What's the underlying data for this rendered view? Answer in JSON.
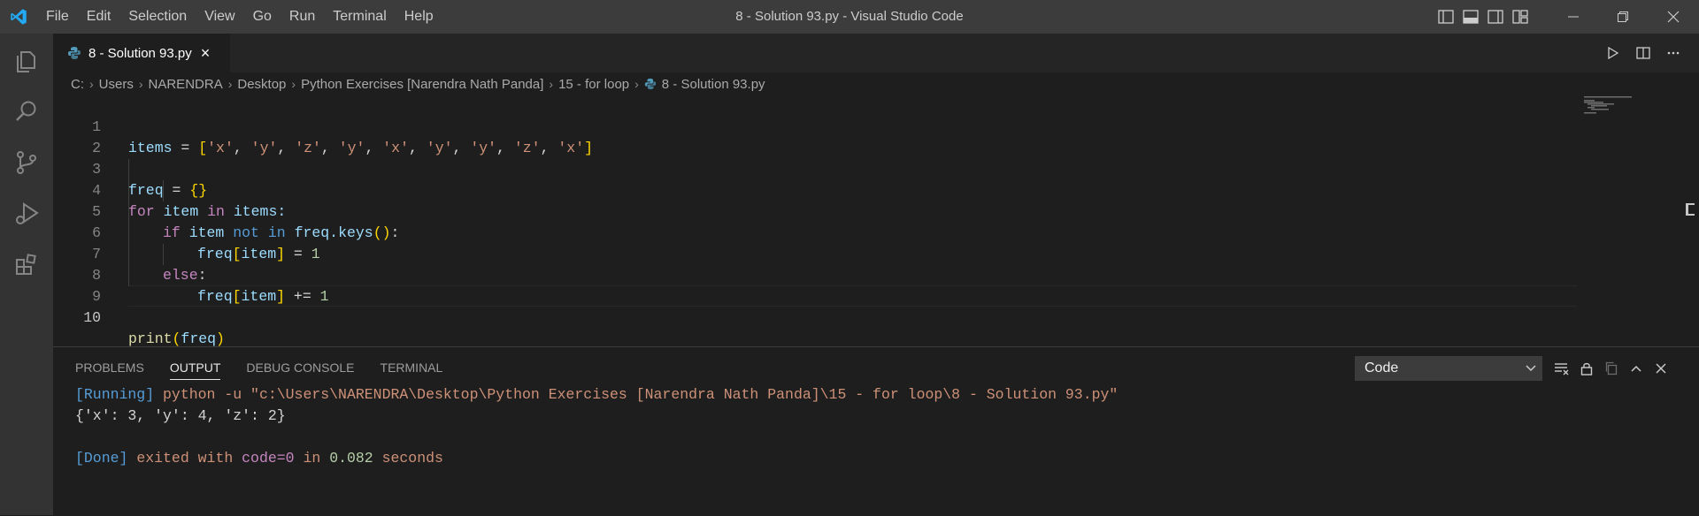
{
  "window": {
    "title": "8 - Solution 93.py - Visual Studio Code",
    "menu": [
      "File",
      "Edit",
      "Selection",
      "View",
      "Go",
      "Run",
      "Terminal",
      "Help"
    ]
  },
  "tab": {
    "label": "8 - Solution 93.py"
  },
  "breadcrumb": [
    "C:",
    "Users",
    "NARENDRA",
    "Desktop",
    "Python Exercises [Narendra Nath Panda]",
    "15 - for loop",
    "8 - Solution 93.py"
  ],
  "editor": {
    "line_numbers": [
      "1",
      "2",
      "3",
      "4",
      "5",
      "6",
      "7",
      "8",
      "9",
      "10"
    ],
    "active_line": "10",
    "code": {
      "l1_items": "items",
      "l1_eq": " = ",
      "l1_lb": "[",
      "l1_values": [
        "'x'",
        "'y'",
        "'z'",
        "'y'",
        "'x'",
        "'y'",
        "'y'",
        "'z'",
        "'x'"
      ],
      "l1_sep": ", ",
      "l1_rb": "]",
      "l3_freq": "freq",
      "l3_eq": " = ",
      "l3_braces": "{}",
      "l4_for": "for",
      "l4_item": " item ",
      "l4_in": "in",
      "l4_items": " items:",
      "l5_if": "if",
      "l5_item": " item ",
      "l5_not": "not",
      "l5_in": "in",
      "l5_freq": " freq.keys",
      "l5_parens": "()",
      "l5_colon": ":",
      "l6_freq": "freq",
      "l6_lb": "[",
      "l6_item": "item",
      "l6_rb": "]",
      "l6_op": " = ",
      "l6_num": "1",
      "l7_else": "else",
      "l7_colon": ":",
      "l8_freq": "freq",
      "l8_lb": "[",
      "l8_item": "item",
      "l8_rb": "]",
      "l8_op": " += ",
      "l8_num": "1",
      "l10_print": "print",
      "l10_lp": "(",
      "l10_freq": "freq",
      "l10_rp": ")"
    }
  },
  "panel": {
    "tabs": [
      "PROBLEMS",
      "OUTPUT",
      "DEBUG CONSOLE",
      "TERMINAL"
    ],
    "active_tab": "OUTPUT",
    "output_channel": "Code",
    "output": {
      "running_tag": "[Running]",
      "running_cmd": " python -u \"c:\\Users\\NARENDRA\\Desktop\\Python Exercises [Narendra Nath Panda]\\15 - for loop\\8 - Solution 93.py\"",
      "result": "{'x': 3, 'y': 4, 'z': 2}",
      "done_tag": "[Done]",
      "done_exited": " exited with ",
      "done_code": "code=0",
      "done_in": " in ",
      "done_time": "0.082",
      "done_seconds": " seconds"
    }
  },
  "colors": {
    "accent": "#007acc",
    "activity_bar": "#333333",
    "titlebar": "#3c3c3c",
    "editor_bg": "#1e1e1e"
  }
}
